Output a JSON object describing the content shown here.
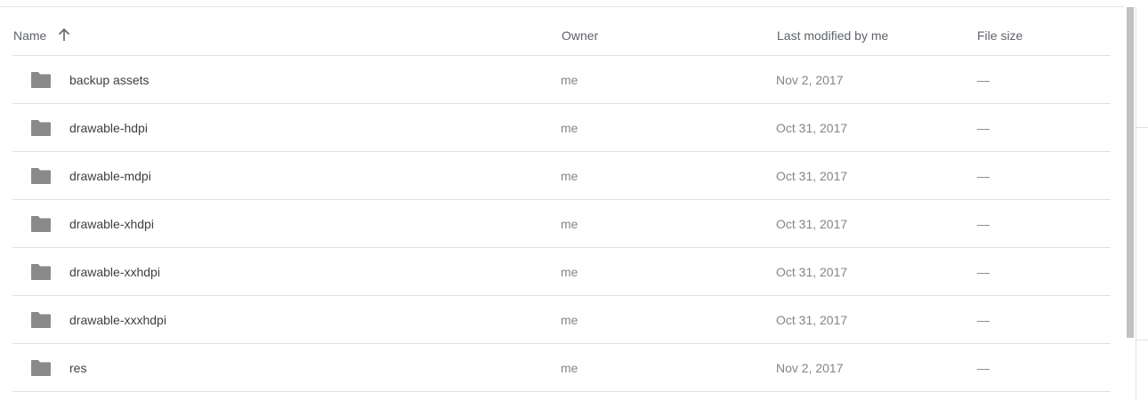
{
  "table": {
    "headers": {
      "name": "Name",
      "owner": "Owner",
      "last_modified": "Last modified by me",
      "file_size": "File size"
    },
    "sort": {
      "column": "name",
      "direction": "ascending",
      "icon": "arrow-up-icon"
    },
    "rows": [
      {
        "icon": "folder-icon",
        "name": "backup assets",
        "owner": "me",
        "last_modified": "Nov 2, 2017",
        "file_size": "—"
      },
      {
        "icon": "folder-icon",
        "name": "drawable-hdpi",
        "owner": "me",
        "last_modified": "Oct 31, 2017",
        "file_size": "—"
      },
      {
        "icon": "folder-icon",
        "name": "drawable-mdpi",
        "owner": "me",
        "last_modified": "Oct 31, 2017",
        "file_size": "—"
      },
      {
        "icon": "folder-icon",
        "name": "drawable-xhdpi",
        "owner": "me",
        "last_modified": "Oct 31, 2017",
        "file_size": "—"
      },
      {
        "icon": "folder-icon",
        "name": "drawable-xxhdpi",
        "owner": "me",
        "last_modified": "Oct 31, 2017",
        "file_size": "—"
      },
      {
        "icon": "folder-icon",
        "name": "drawable-xxxhdpi",
        "owner": "me",
        "last_modified": "Oct 31, 2017",
        "file_size": "—"
      },
      {
        "icon": "folder-icon",
        "name": "res",
        "owner": "me",
        "last_modified": "Nov 2, 2017",
        "file_size": "—"
      }
    ]
  },
  "colors": {
    "folder": "#8a8a8a",
    "divider": "#e0e0e0",
    "scrollbar_thumb": "#c1c1c1"
  }
}
